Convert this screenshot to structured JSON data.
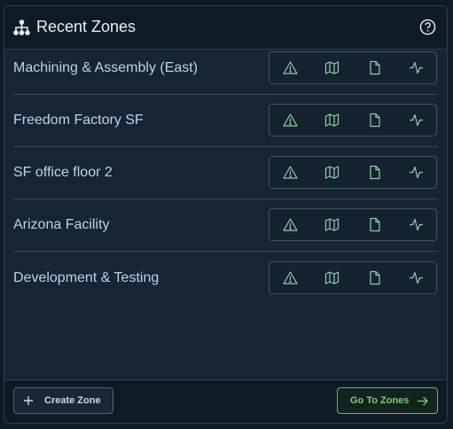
{
  "header": {
    "title": "Recent Zones",
    "title_icon": "hierarchy-icon",
    "help_icon": "help-circle-icon"
  },
  "zones": [
    {
      "name": "Machining & Assembly (East)"
    },
    {
      "name": "Freedom Factory SF"
    },
    {
      "name": "SF office floor 2"
    },
    {
      "name": "Arizona Facility"
    },
    {
      "name": "Development & Testing"
    }
  ],
  "row_actions": [
    "alert-triangle-icon",
    "map-icon",
    "file-icon",
    "activity-icon"
  ],
  "footer": {
    "create_label": "Create Zone",
    "go_label": "Go To Zones"
  },
  "colors": {
    "background": "#111a24",
    "card": "#172432",
    "header": "#0f1a25",
    "zone_text": "#b9d3ee",
    "icon": "#8ed0a8",
    "accent_green": "#7ccb7c"
  }
}
